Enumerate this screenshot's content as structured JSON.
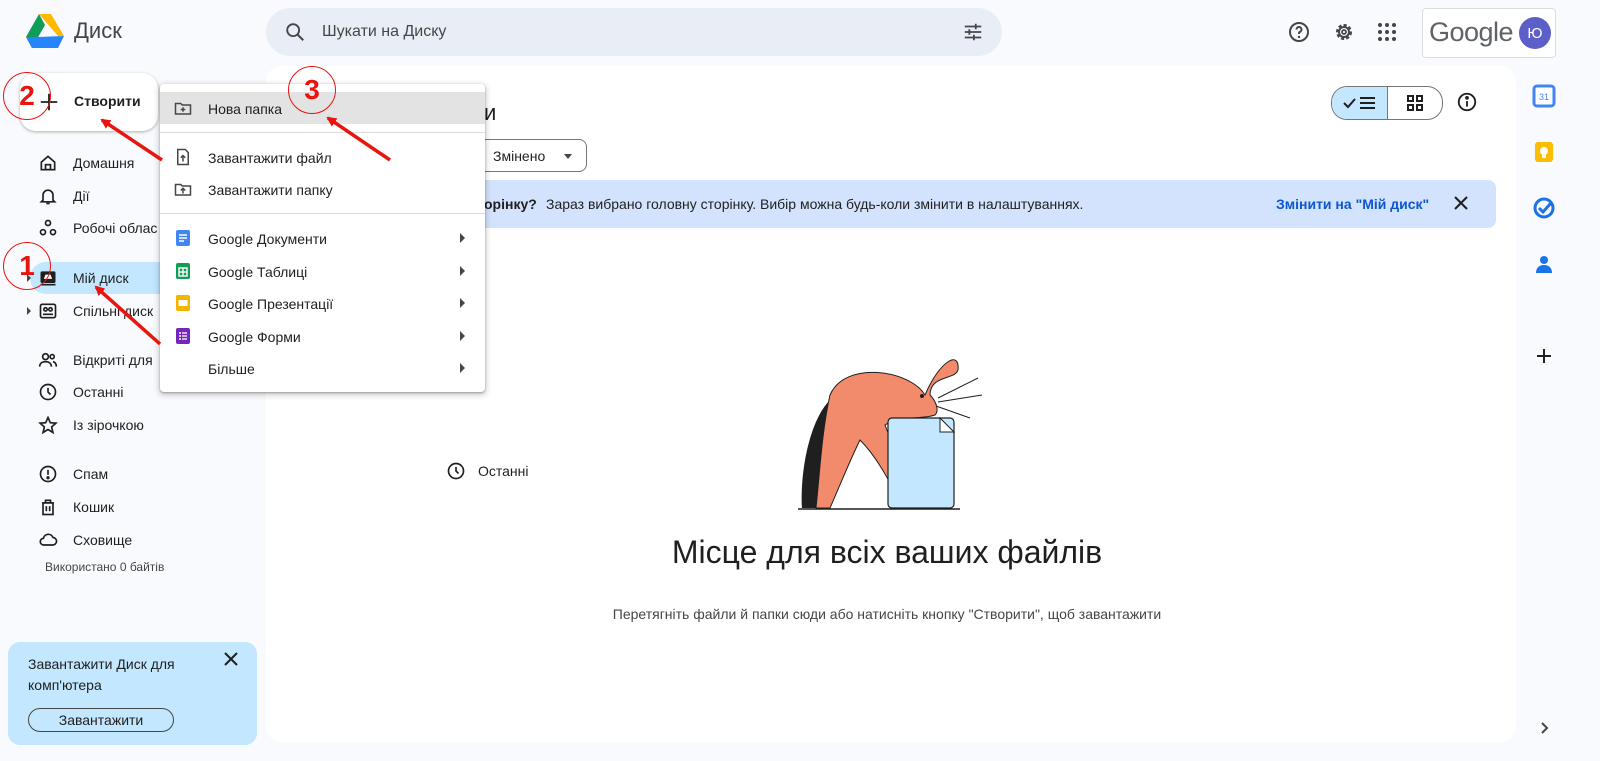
{
  "app": {
    "title": "Диск"
  },
  "search": {
    "placeholder": "Шукати на Диску"
  },
  "account": {
    "brand": "Google",
    "avatar_letter": "Ю"
  },
  "create": {
    "label": "Створити"
  },
  "sidebar": {
    "items": [
      {
        "label": "Домашня",
        "icon": "home-icon"
      },
      {
        "label": "Дії",
        "icon": "bell-icon"
      },
      {
        "label": "Робочі облас",
        "icon": "workspaces-icon"
      },
      {
        "label": "Мій диск",
        "icon": "my-drive-icon",
        "active": true
      },
      {
        "label": "Спільні диск",
        "icon": "shared-drives-icon"
      },
      {
        "label": "Відкриті для",
        "icon": "shared-with-me-icon"
      },
      {
        "label": "Останні",
        "icon": "clock-icon"
      },
      {
        "label": "Із зірочкою",
        "icon": "star-icon"
      },
      {
        "label": "Спам",
        "icon": "spam-icon"
      },
      {
        "label": "Кошик",
        "icon": "trash-icon"
      },
      {
        "label": "Сховище",
        "icon": "cloud-icon"
      }
    ],
    "storage_text": "Використано 0 байтів"
  },
  "promo": {
    "text": "Завантажити Диск для комп'ютера",
    "button": "Завантажити"
  },
  "menu": {
    "items": [
      {
        "label": "Нова папка",
        "icon": "new-folder-icon",
        "highlighted": true
      },
      {
        "label": "Завантажити файл",
        "icon": "file-upload-icon"
      },
      {
        "label": "Завантажити папку",
        "icon": "folder-upload-icon"
      },
      {
        "label": "Google Документи",
        "icon": "docs-icon",
        "color": "#4285f4",
        "submenu": true
      },
      {
        "label": "Google Таблиці",
        "icon": "sheets-icon",
        "color": "#0f9d58",
        "submenu": true
      },
      {
        "label": "Google Презентації",
        "icon": "slides-icon",
        "color": "#f4b400",
        "submenu": true
      },
      {
        "label": "Google Форми",
        "icon": "forms-icon",
        "color": "#7627bb",
        "submenu": true
      },
      {
        "label": "Більше",
        "icon": "",
        "submenu": true
      }
    ]
  },
  "main": {
    "title_fragment": "и",
    "filter_chip": "Змінено",
    "peek_label": "Останні",
    "banner": {
      "bold": "орінку?",
      "text": "Зараз вибрано головну сторінку. Вибір можна будь-коли змінити в налаштуваннях.",
      "link": "Змінити на \"Мій диск\""
    },
    "empty": {
      "title": "Місце для всіх ваших файлів",
      "subtitle": "Перетягніть файли й папки сюди або натисніть кнопку \"Створити\", щоб завантажити"
    }
  },
  "annotations": {
    "step1": "1",
    "step2": "2",
    "step3": "3"
  },
  "colors": {
    "accent": "#0b57d0",
    "active_bg": "#c2e7ff",
    "annotation": "#e8140e"
  }
}
